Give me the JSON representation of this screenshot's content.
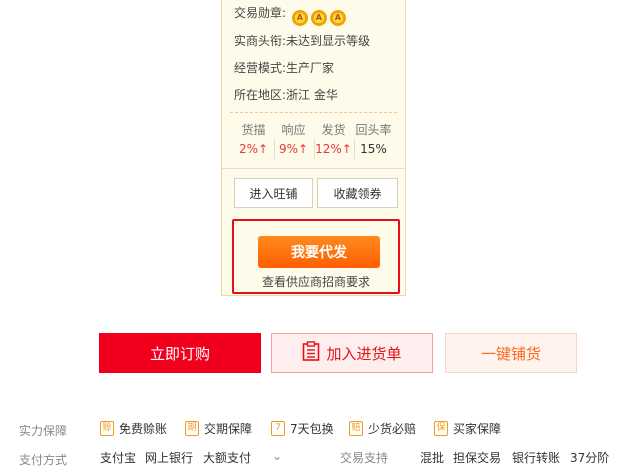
{
  "supplier": {
    "medal_label": "交易勋章:",
    "medal_letter": "A",
    "title_label": "实商头衔:",
    "title_value": "未达到显示等级",
    "mode_label": "经营模式:",
    "mode_value": "生产厂家",
    "region_label": "所在地区:",
    "region_value": "浙江 金华",
    "stats": [
      {
        "label": "货描",
        "value": "2%↑"
      },
      {
        "label": "响应",
        "value": "9%↑"
      },
      {
        "label": "发货",
        "value": "12%↑"
      },
      {
        "label": "回头率",
        "value": "15%"
      }
    ],
    "enter_shop": "进入旺铺",
    "favorite": "收藏领券",
    "dropship_button": "我要代发",
    "dropship_link": "查看供应商招商要求"
  },
  "actions": {
    "order": "立即订购",
    "cart": "加入进货单",
    "publish": "一键铺货"
  },
  "guarantee": {
    "label": "实力保障",
    "items": [
      {
        "icon": "赊",
        "label": "免费赊账"
      },
      {
        "icon": "期",
        "label": "交期保障"
      },
      {
        "icon": "7",
        "label": "7天包换"
      },
      {
        "icon": "赔",
        "label": "少货必赔"
      },
      {
        "icon": "保",
        "label": "买家保障"
      }
    ]
  },
  "payment": {
    "label": "支付方式",
    "methods": [
      "支付宝",
      "网上银行",
      "大额支付"
    ],
    "chevron": "⌄",
    "support_label": "交易支持",
    "support": [
      "混批",
      "担保交易",
      "银行转账"
    ],
    "time": "37分阶"
  }
}
